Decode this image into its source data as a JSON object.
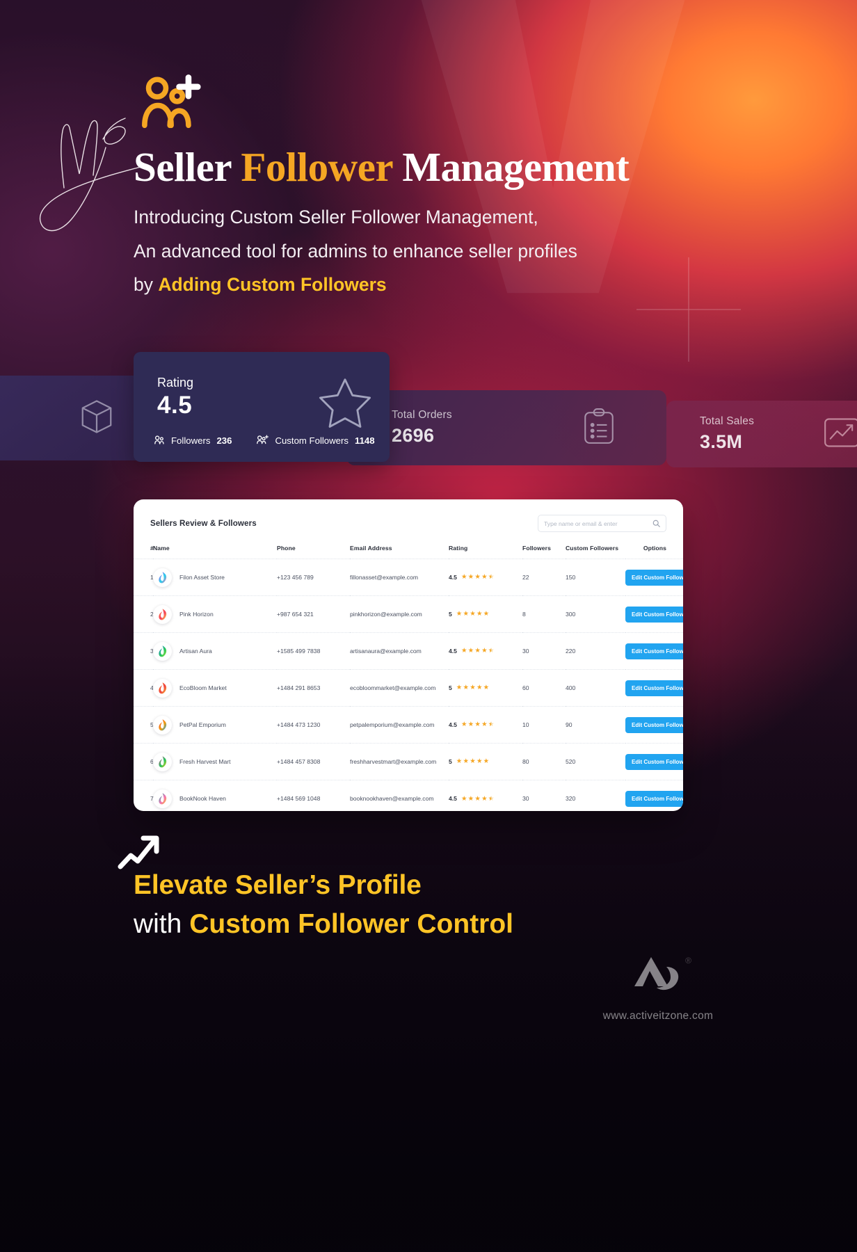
{
  "hero": {
    "script_word": "New",
    "people_icon": "people-add-icon",
    "title_part1": "Seller ",
    "title_accent": "Follower",
    "title_part2": " Management",
    "sub_line1": "Introducing Custom Seller Follower Management,",
    "sub_line2": "An advanced tool for admins to enhance seller profiles",
    "sub_line3_prefix": "by ",
    "sub_line3_accent": "Adding Custom Followers"
  },
  "stats": {
    "rating": {
      "label": "Rating",
      "value": "4.5",
      "star_icon": "star-outline-icon",
      "followers_icon": "people-icon",
      "followers_label": "Followers",
      "followers_value": "236",
      "custom_icon": "people-add-icon",
      "custom_label": "Custom Followers",
      "custom_value": "1148"
    },
    "orders": {
      "label": "Total Orders",
      "value": "2696",
      "icon": "clipboard-list-icon"
    },
    "sales": {
      "label": "Total Sales",
      "value": "3.5M",
      "icon": "line-chart-icon"
    },
    "box": {
      "icon": "package-box-icon"
    }
  },
  "panel": {
    "title": "Sellers Review & Followers",
    "search": {
      "placeholder": "Type name or email & enter",
      "value": "",
      "icon": "search-icon"
    },
    "columns": [
      "#",
      "Name",
      "Phone",
      "Email Address",
      "Rating",
      "Followers",
      "Custom Followers",
      "Options"
    ],
    "action_label": "Edit Custom Follower",
    "rows": [
      {
        "index": "1",
        "name": "Filon Asset Store",
        "phone": "+123 456 789",
        "email": "fillonasset@example.com",
        "rating": "4.5",
        "stars": 4.5,
        "followers": "22",
        "custom_followers": "150",
        "avatar": "filon-logo-icon"
      },
      {
        "index": "2",
        "name": "Pink Horizon",
        "phone": "+987 654 321",
        "email": "pinkhorizon@example.com",
        "rating": "5",
        "stars": 5,
        "followers": "8",
        "custom_followers": "300",
        "avatar": "pink-horizon-logo-icon"
      },
      {
        "index": "3",
        "name": "Artisan Aura",
        "phone": "+1585 499 7838",
        "email": "artisanaura@example.com",
        "rating": "4.5",
        "stars": 4.5,
        "followers": "30",
        "custom_followers": "220",
        "avatar": "artisan-aura-logo-icon"
      },
      {
        "index": "4",
        "name": "EcoBloom Market",
        "phone": "+1484 291 8653",
        "email": "ecobloommarket@example.com",
        "rating": "5",
        "stars": 5,
        "followers": "60",
        "custom_followers": "400",
        "avatar": "ecobloom-logo-icon"
      },
      {
        "index": "5",
        "name": "PetPal Emporium",
        "phone": "+1484 473 1230",
        "email": "petpalemporium@example.com",
        "rating": "4.5",
        "stars": 4.5,
        "followers": "10",
        "custom_followers": "90",
        "avatar": "petpal-logo-icon"
      },
      {
        "index": "6",
        "name": "Fresh Harvest Mart",
        "phone": "+1484 457 8308",
        "email": "freshharvestmart@example.com",
        "rating": "5",
        "stars": 5,
        "followers": "80",
        "custom_followers": "520",
        "avatar": "fresh-harvest-logo-icon"
      },
      {
        "index": "7",
        "name": "BookNook Haven",
        "phone": "+1484 569 1048",
        "email": "booknookhaven@example.com",
        "rating": "4.5",
        "stars": 4.5,
        "followers": "30",
        "custom_followers": "320",
        "avatar": "booknook-logo-icon"
      }
    ]
  },
  "tagline": {
    "arrow_icon": "growth-arrow-icon",
    "line1": "Elevate Seller’s Profile",
    "line2_prefix": "with ",
    "line2_accent": "Custom Follower Control"
  },
  "footer": {
    "logo_icon": "activeit-logo-icon",
    "registered_mark": "®",
    "url": "www.activeitzone.com"
  },
  "colors": {
    "accent_yellow": "#ffc426",
    "title_accent": "#f5a623",
    "button_blue": "#21a4f0",
    "card_navy": "#2f2b55",
    "panel_white": "#ffffff"
  }
}
